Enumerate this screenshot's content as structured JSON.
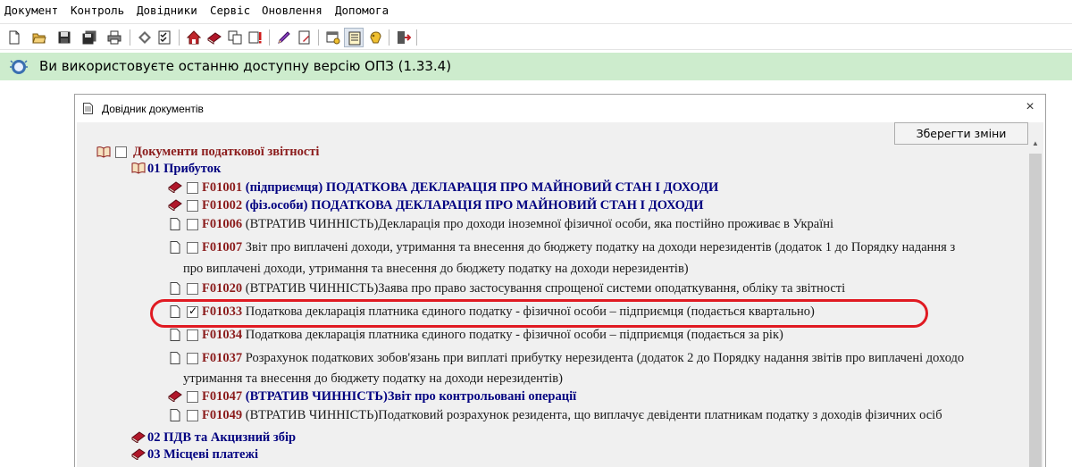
{
  "menu": [
    "Документ",
    "Контроль",
    "Довідники",
    "Сервіс",
    "Оновлення",
    "Допомога"
  ],
  "toolbar": {
    "icons": [
      "new-document-icon",
      "open-folder-icon",
      "save-icon",
      "save-all-icon",
      "print-icon",
      "diamond-tool-icon",
      "checklist-icon",
      "home-icon",
      "red-book-icon",
      "copy-documents-icon",
      "alert-icon",
      "pen-tool-icon",
      "document-edit-icon",
      "settings-window-icon",
      "directory-icon",
      "hand-icon",
      "exit-icon"
    ]
  },
  "info_bar": {
    "text": "Ви використовуєте останню доступну версію ОПЗ (1.33.4)",
    "color": "#cdeccd"
  },
  "dialog": {
    "title": "Довідник документів",
    "close_label": "×",
    "save_button": "Зберегти зміни"
  },
  "tree": {
    "root": "Документи податкової звітності",
    "group_1": "01 Прибуток",
    "items": [
      {
        "code": "F01001",
        "text": "(підприємця) ПОДАТКОВА ДЕКЛАРАЦІЯ ПРО МАЙНОВИЙ СТАН І ДОХОДИ",
        "checked": false
      },
      {
        "code": "F01002",
        "text": "(фіз.особи) ПОДАТКОВА ДЕКЛАРАЦІЯ ПРО МАЙНОВИЙ СТАН І ДОХОДИ",
        "checked": false
      },
      {
        "code": "F01006",
        "text": "(ВТРАТИВ ЧИННІСТЬ)Декларація про доходи іноземної фізичної особи, яка постійно проживає в Україні",
        "checked": false
      },
      {
        "code": "F01007",
        "text": "Звіт про виплачені доходи, утримання та внесення до бюджету податку на доходи нерезидентів (додаток 1 до Порядку надання з",
        "text2": "про виплачені доходи, утримання та внесення до бюджету податку на доходи нерезидентів)",
        "checked": false
      },
      {
        "code": "F01020",
        "text": "(ВТРАТИВ ЧИННІСТЬ)Заява про право застосування спрощеної системи оподаткування, обліку та звітності",
        "checked": false
      },
      {
        "code": "F01033",
        "text": "Податкова декларація платника єдиного податку - фізичної особи – підприємця (подається квартально)",
        "checked": true
      },
      {
        "code": "F01034",
        "text": "Податкова декларація платника єдиного податку - фізичної особи – підприємця (подається за рік)",
        "checked": false
      },
      {
        "code": "F01037",
        "text": "Розрахунок податкових зобов'язань при виплаті прибутку нерезидента (додаток 2 до Порядку надання звітів про виплачені доходо",
        "text2": "утримання та внесення до бюджету податку на доходи нерезидентів)",
        "checked": false
      },
      {
        "code": "F01047",
        "text": "(ВТРАТИВ ЧИННІСТЬ)Звіт про контрольовані операції",
        "checked": false
      },
      {
        "code": "F01049",
        "text": "(ВТРАТИВ ЧИННІСТЬ)Податковий розрахунок резидента, що виплачує девіденти платникам податку з доходів фізичних осіб",
        "checked": false
      }
    ],
    "group_2": "02 ПДВ та Акцизний збір",
    "group_3": "03 Місцеві платежі"
  }
}
